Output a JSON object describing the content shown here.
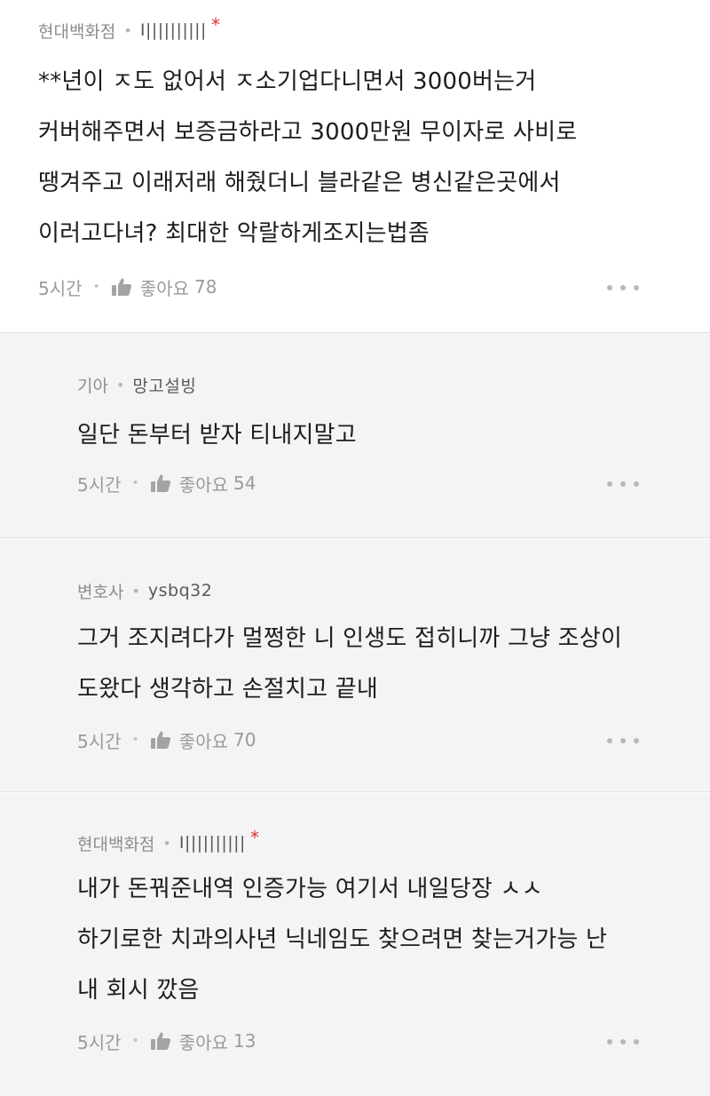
{
  "comments": [
    {
      "company": "현대백화점",
      "nickname": "Ⅰ||||||||||",
      "verified_mark": "*",
      "lines": [
        "**년이 ㅈ도 없어서 ㅈ소기업다니면서 3000버는거",
        "커버해주면서 보증금하라고 3000만원 무이자로 사비로",
        "땡겨주고 이래저래 해줬더니 블라같은 병신같은곳에서",
        "이러고다녀? 최대한 악랄하게조지는법좀"
      ],
      "time": "5시간",
      "like_label": "좋아요",
      "like_count": "78"
    },
    {
      "company": "기아",
      "nickname": "망고설빙",
      "lines": [
        "일단 돈부터 받자 티내지말고"
      ],
      "time": "5시간",
      "like_label": "좋아요",
      "like_count": "54"
    },
    {
      "company": "변호사",
      "nickname": "ysbq32",
      "lines": [
        "그거 조지려다가 멀쩡한 니 인생도 접히니까 그냥 조상이",
        "도왔다 생각하고 손절치고 끝내"
      ],
      "time": "5시간",
      "like_label": "좋아요",
      "like_count": "70"
    },
    {
      "company": "현대백화점",
      "nickname": "Ⅰ||||||||||",
      "verified_mark": "*",
      "lines": [
        "내가 돈꿔준내역 인증가능 여기서 내일당장 ㅅㅅ",
        "하기로한 치과의사년 닉네임도 찾으려면 찾는거가능 난",
        "내 회시 깠음"
      ],
      "time": "5시간",
      "like_label": "좋아요",
      "like_count": "13"
    }
  ],
  "colors": {
    "verified_mark": "#e0313a",
    "reply_background": "#f4f4f4",
    "meta_text": "#8a8a8a"
  },
  "icons": {
    "like": "thumbs-up-icon",
    "more": "more-dots-icon"
  }
}
